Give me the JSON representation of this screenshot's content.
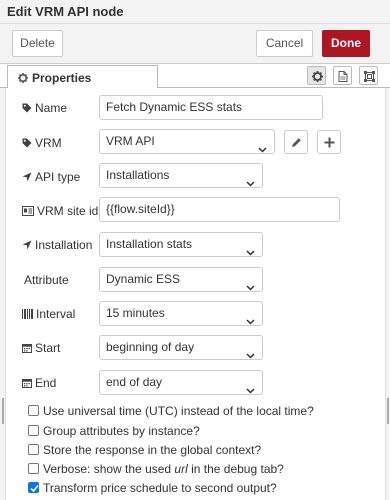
{
  "dialog": {
    "title": "Edit VRM API node"
  },
  "toolbar": {
    "delete_label": "Delete",
    "cancel_label": "Cancel",
    "done_label": "Done"
  },
  "tabs": {
    "properties_label": "Properties"
  },
  "form": {
    "name": {
      "label": "Name",
      "value": "Fetch Dynamic ESS stats"
    },
    "vrm": {
      "label": "VRM",
      "value": "VRM API"
    },
    "api_type": {
      "label": "API type",
      "value": "Installations"
    },
    "site_id": {
      "label": "VRM site id",
      "value": "{{flow.siteId}}"
    },
    "installation": {
      "label": "Installation",
      "value": "Installation stats"
    },
    "attribute": {
      "label": "Attribute",
      "value": "Dynamic ESS"
    },
    "interval": {
      "label": "Interval",
      "value": "15 minutes"
    },
    "start": {
      "label": "Start",
      "value": "beginning of day"
    },
    "end": {
      "label": "End",
      "value": "end of day"
    }
  },
  "checkboxes": [
    {
      "label": "Use universal time (UTC) instead of the local time?",
      "checked": false
    },
    {
      "label": "Group attributes by instance?",
      "checked": false
    },
    {
      "label": "Store the response in the global context?",
      "checked": false
    },
    {
      "label_before": "Verbose: show the used ",
      "label_em": "url",
      "label_after": " in the debug tab?",
      "checked": false
    },
    {
      "label": "Transform price schedule to second output?",
      "checked": true
    }
  ],
  "colors": {
    "done_button": "#ad1625",
    "checkbox_checked": "#0b74e4"
  },
  "icons": [
    "gear-icon",
    "file-icon",
    "frame-icon",
    "tag-icon",
    "location-arrow-icon",
    "id-card-icon",
    "barcode-icon",
    "calendar-icon",
    "pencil-icon",
    "plus-icon",
    "chevron-down-icon",
    "checkmark-icon"
  ]
}
